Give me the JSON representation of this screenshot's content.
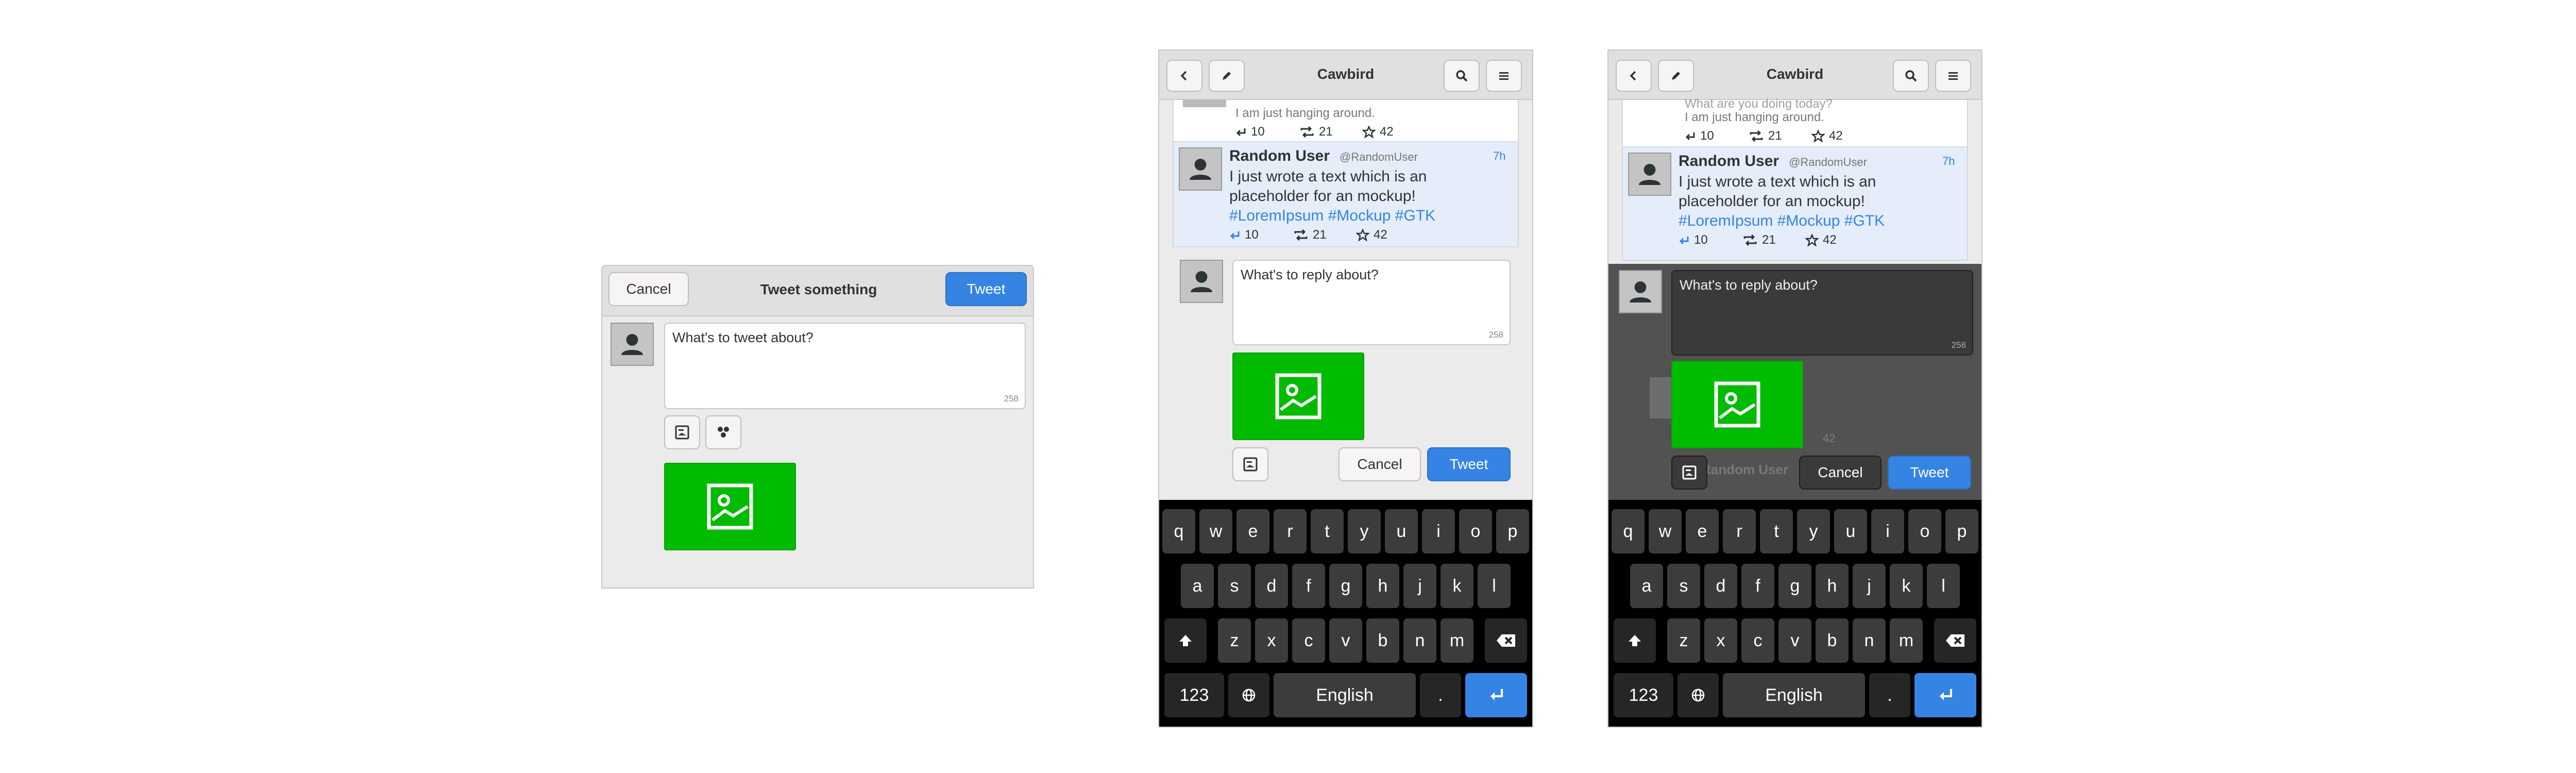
{
  "composer": {
    "cancel_label": "Cancel",
    "title": "Tweet something",
    "tweet_label": "Tweet",
    "placeholder": "What's to tweet about?",
    "char_count": "258"
  },
  "reply_panel": {
    "app_title": "Cawbird",
    "prev_tweet": {
      "line_partial": "What are you doing today?",
      "text": "I am just hanging around.",
      "replies": "10",
      "retweets": "21",
      "likes": "42"
    },
    "tweet": {
      "author": "Random User",
      "handle": "@RandomUser",
      "time": "7h",
      "text_line1": "I just wrote a text which is an",
      "text_line2": "placeholder for an mockup!",
      "hashtags": "#LoremIpsum #Mockup #GTK",
      "replies": "10",
      "retweets": "21",
      "likes": "42"
    },
    "reply_placeholder": "What's to reply about?",
    "char_count": "258",
    "cancel_label": "Cancel",
    "tweet_label": "Tweet"
  },
  "reply_overlay_panel": {
    "app_title": "Cawbird",
    "bg_partial": "Random User",
    "bg_count": "42"
  },
  "keyboard": {
    "row1": [
      "q",
      "w",
      "e",
      "r",
      "t",
      "y",
      "u",
      "i",
      "o",
      "p"
    ],
    "row2": [
      "a",
      "s",
      "d",
      "f",
      "g",
      "h",
      "j",
      "k",
      "l"
    ],
    "row3": [
      "z",
      "x",
      "c",
      "v",
      "b",
      "n",
      "m"
    ],
    "numbers_label": "123",
    "language_label": "English",
    "period_label": "."
  },
  "colors": {
    "accent": "#3584e4",
    "media_green": "#00bb00",
    "highlight": "#e4edf9"
  },
  "icons": [
    "back-icon",
    "edit-icon",
    "search-icon",
    "menu-icon",
    "image-icon",
    "poll-icon",
    "shift-icon",
    "backspace-icon",
    "globe-icon",
    "enter-icon",
    "reply-icon",
    "retweet-icon",
    "star-icon",
    "avatar-icon"
  ]
}
